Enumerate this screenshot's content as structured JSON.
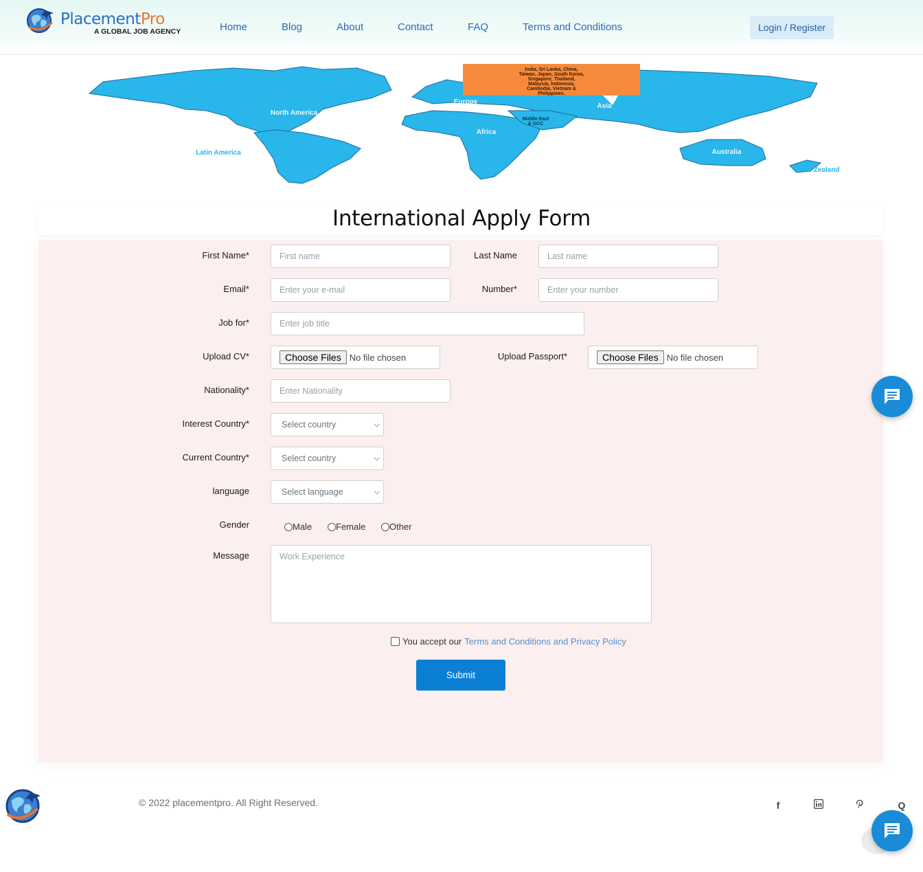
{
  "brand": {
    "name_part1": "Placement",
    "name_part2": "Pro",
    "tagline": "A GLOBAL JOB AGENCY"
  },
  "nav": {
    "items": [
      "Home",
      "Blog",
      "About",
      "Contact",
      "FAQ",
      "Terms and Conditions"
    ],
    "login_label": "Login / Register"
  },
  "hero_map": {
    "callout": "India, Sri Lanka, China, Taiwan, Japan, South Korea, Singapore, Thailand, Malaysia, Indonesia, Cambodia, Vietnam & Philippines.",
    "regions": [
      "North America",
      "Latin America",
      "Europe",
      "Africa",
      "Middle East & GCC",
      "Asia",
      "Australia",
      "New Zealand"
    ]
  },
  "form": {
    "title": "International Apply Form",
    "first_name": {
      "label": "First Name*",
      "placeholder": "First name"
    },
    "last_name": {
      "label": "Last Name",
      "placeholder": "Last name"
    },
    "email": {
      "label": "Email*",
      "placeholder": "Enter your e-mail"
    },
    "number": {
      "label": "Number*",
      "placeholder": "Enter your number"
    },
    "job_for": {
      "label": "Job for*",
      "placeholder": "Enter job title"
    },
    "upload_cv": {
      "label": "Upload CV*",
      "button": "Choose Files",
      "status": "No file chosen"
    },
    "upload_passport": {
      "label": "Upload Passport*",
      "button": "Choose Files",
      "status": "No file chosen"
    },
    "nationality": {
      "label": "Nationality*",
      "placeholder": "Enter Nationality"
    },
    "interest_country": {
      "label": "Interest Country*",
      "selected": "Select country"
    },
    "current_country": {
      "label": "Current Country*",
      "selected": "Select country"
    },
    "language": {
      "label": "language",
      "selected": "Select language"
    },
    "gender": {
      "label": "Gender",
      "options": [
        "Male",
        "Female",
        "Other"
      ]
    },
    "message": {
      "label": "Message",
      "placeholder": "Work Experience"
    },
    "accept_text": "You accept our",
    "accept_link": "Terms and Conditions and Privacy Policy",
    "submit_label": "Submit"
  },
  "footer": {
    "copyright": "© 2022 placementpro. All Right Reserved.",
    "social_icons": [
      "facebook-icon",
      "linkedin-icon",
      "pinterest-icon",
      "quora-icon"
    ]
  },
  "colors": {
    "brand_blue": "#2b6cc4",
    "brand_orange": "#e8742e",
    "map_blue": "#29b6ea",
    "callout_orange": "#f58a3c",
    "form_bg": "#fcefef",
    "submit_bg": "#0b7fd3",
    "chat_bg": "#1a8bd6"
  }
}
